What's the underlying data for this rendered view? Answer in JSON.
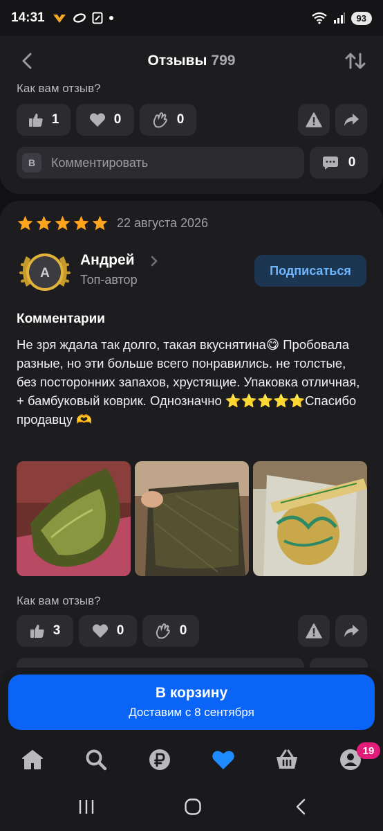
{
  "status_bar": {
    "time": "14:31",
    "battery": "93",
    "icons": [
      "app-notification-icon",
      "oval-icon",
      "sim-icon",
      "dot-icon",
      "wifi-icon",
      "signal-icon"
    ]
  },
  "header": {
    "title": "Отзывы",
    "count": "799",
    "back_icon": "back-arrow-icon",
    "sort_icon": "sort-icon"
  },
  "prev_review": {
    "question": "Как вам отзыв?",
    "likes": "1",
    "hearts": "0",
    "claps": "0",
    "comment_avatar_letter": "В",
    "comment_placeholder": "Комментировать",
    "comments": "0"
  },
  "review": {
    "rating": 5,
    "date": "22 августа 2026",
    "author": {
      "name": "Андрей",
      "initial": "А",
      "role": "Топ-автор"
    },
    "subscribe_label": "Подписаться",
    "section_title": "Комментарии",
    "text": "Не зря ждала так долго, такая вкуснятина😋 Пробовала разные, но эти больше всего понравились. не толстые, без посторонних запахов, хрустящие. Упаковка отличная, + бамбуковый коврик. Однозначно ⭐⭐⭐⭐⭐Спасибо продавцу 🫶",
    "photos": [
      "nori-sheet-photo",
      "nori-sheet-closeup-photo",
      "bamboo-mat-package-photo"
    ],
    "question": "Как вам отзыв?",
    "likes": "3",
    "hearts": "0",
    "claps": "0"
  },
  "cart": {
    "title": "В корзину",
    "subtitle": "Доставим с 8 сентября"
  },
  "nav": {
    "items": [
      "home-icon",
      "search-icon",
      "ruble-icon",
      "favorites-icon",
      "basket-icon",
      "profile-icon"
    ],
    "profile_badge": "19",
    "accent_color": "#1e8cff"
  },
  "system_nav": [
    "recent-apps-icon",
    "home-circle-icon",
    "back-icon"
  ]
}
